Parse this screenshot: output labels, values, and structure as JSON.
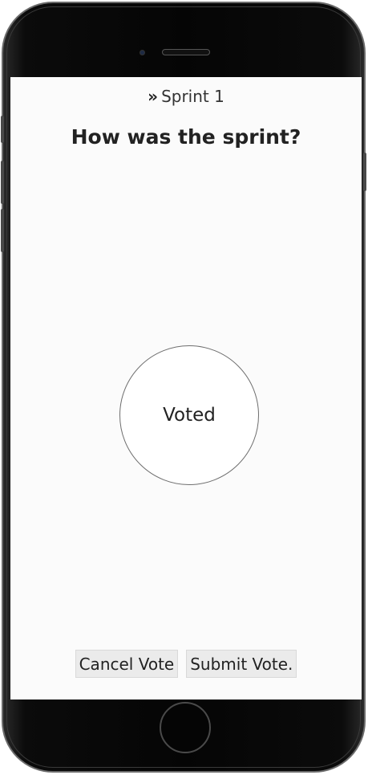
{
  "header": {
    "sprint_icon": "double-chevron-right-icon",
    "sprint_label": "Sprint 1"
  },
  "main": {
    "question": "How was the sprint?",
    "vote_status": "Voted"
  },
  "actions": {
    "cancel_label": "Cancel Vote",
    "submit_label": "Submit Vote."
  }
}
